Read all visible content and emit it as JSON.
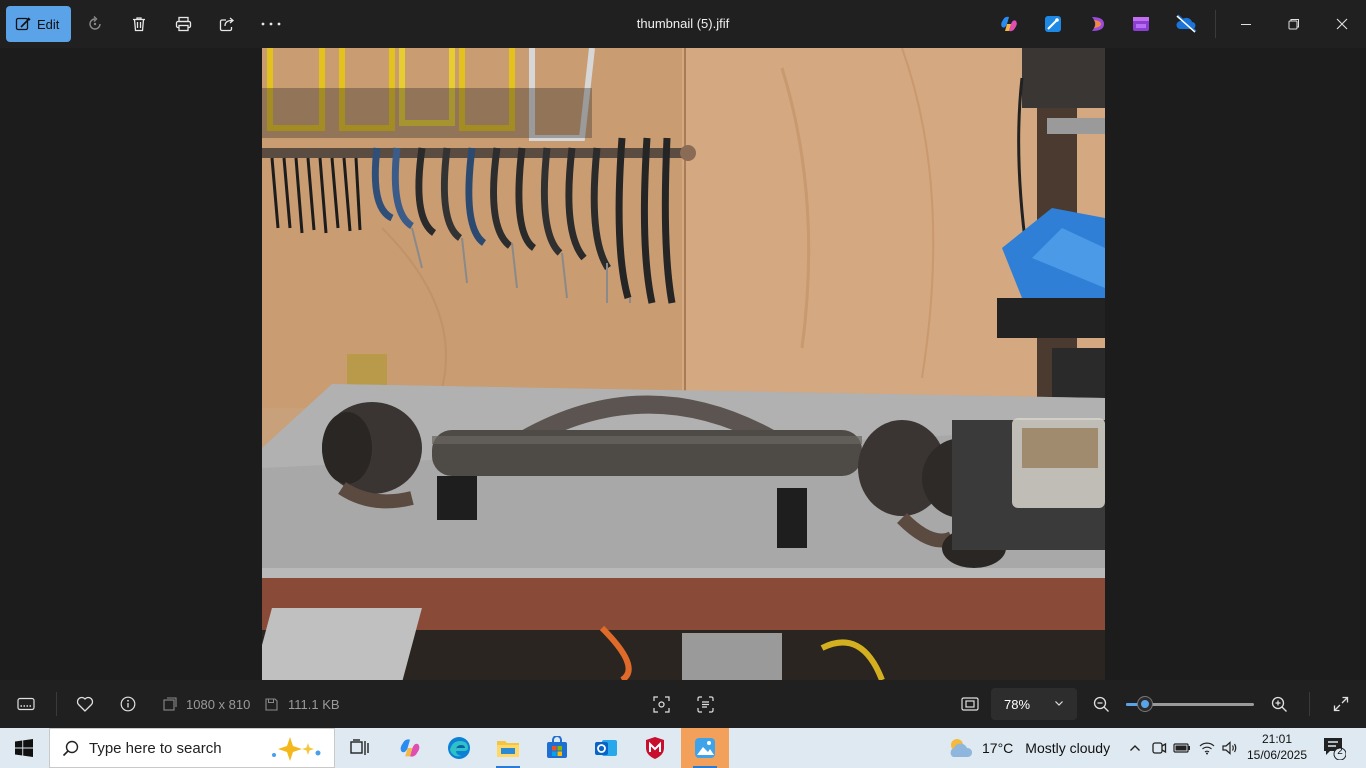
{
  "toolbar": {
    "edit_label": "Edit",
    "title": "thumbnail (5).jfif"
  },
  "info": {
    "dimensions": "1080 x 810",
    "file_size": "111.1 KB"
  },
  "zoom": {
    "value": "78%",
    "slider_level_percent": 15
  },
  "taskbar": {
    "search_placeholder": "Type here to search",
    "weather_temp": "17°C",
    "weather_desc": "Mostly cloudy",
    "time": "21:01",
    "date": "15/06/2025",
    "notification_count": "2"
  },
  "colors": {
    "accent": "#5aa3e8",
    "active_app": "#f3a15a"
  }
}
